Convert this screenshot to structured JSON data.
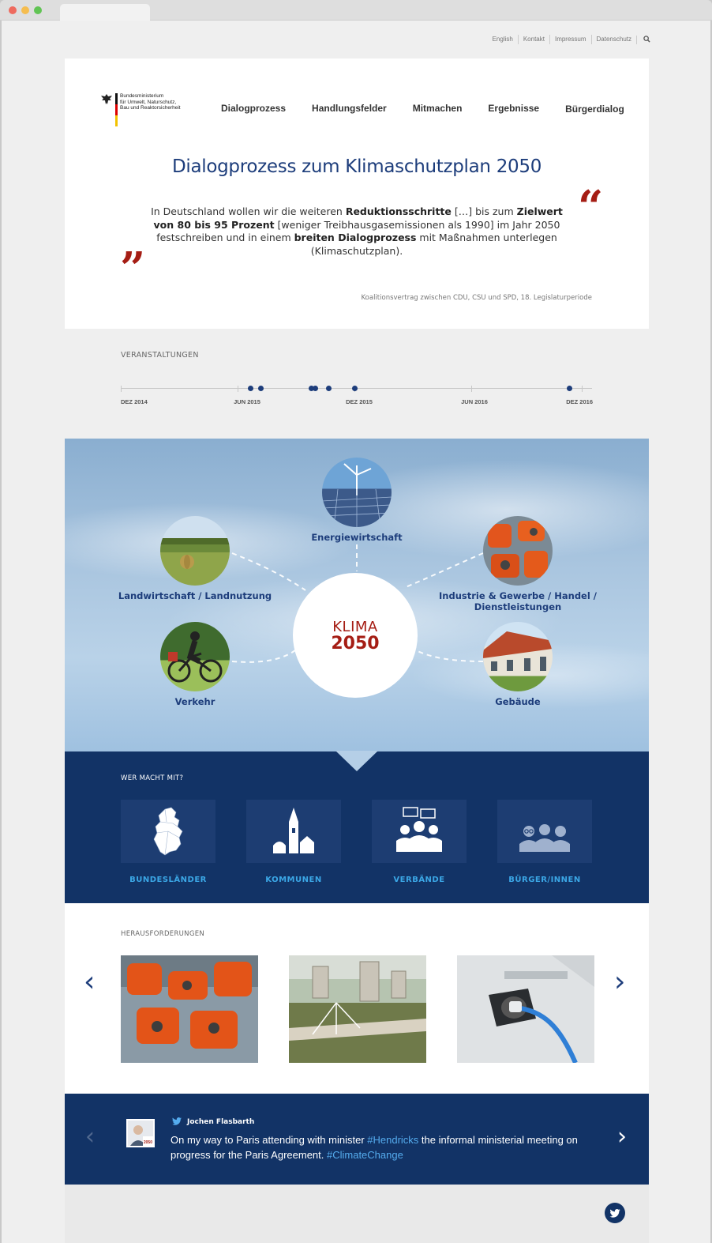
{
  "util_nav": {
    "english": "English",
    "contact": "Kontakt",
    "imprint": "Impressum",
    "privacy": "Datenschutz"
  },
  "logo": {
    "line1": "Bundesministerium",
    "line2": "für Umwelt, Naturschutz,",
    "line3": "Bau und Reaktorsicherheit"
  },
  "nav": [
    "Dialogprozess",
    "Handlungsfelder",
    "Mitmachen",
    "Ergebnisse",
    "Bürgerdialog"
  ],
  "hero": {
    "title": "Dialogprozess zum Klimaschutzplan 2050",
    "quote": {
      "p1": "In Deutschland wollen wir die weiteren ",
      "b1": "Reduktionsschritte",
      "p2": " […] bis zum ",
      "b2": "Zielwert von 80 bis 95 Prozent",
      "p3": " [weniger Treibhausgasemissionen als 1990] im Jahr 2050 festschreiben und in einem ",
      "b3": "breiten Dialogprozess",
      "p4": " mit Maßnahmen unterlegen (Klimaschutzplan)."
    },
    "quote_open": "“",
    "quote_close": "”",
    "source": "Koalitionsvertrag zwischen CDU, CSU und SPD, 18. Legislaturperiode"
  },
  "events": {
    "label": "VERANSTALTUNGEN",
    "ticks": [
      "DEZ 2014",
      "JUN 2015",
      "DEZ 2015",
      "JUN 2016",
      "DEZ 2016"
    ]
  },
  "klima": {
    "center_top": "KLIMA",
    "center_bottom": "2050",
    "topics": {
      "energie": "Energiewirtschaft",
      "land": "Landwirtschaft / Landnutzung",
      "industrie": "Industrie & Gewerbe / Handel / Dienstleistungen",
      "verkehr": "Verkehr",
      "gebaeude": "Gebäude"
    }
  },
  "who": {
    "label": "WER MACHT MIT?",
    "items": [
      "BUNDESLÄNDER",
      "KOMMUNEN",
      "VERBÄNDE",
      "BÜRGER/INNEN"
    ]
  },
  "challenges": {
    "label": "HERAUSFORDERUNGEN",
    "prev": "‹",
    "next": "›"
  },
  "tweet": {
    "user": "Jochen Flasbarth",
    "t1": "On my way to Paris attending with minister ",
    "h1": "#Hendricks",
    "t2": " the informal ministerial meeting on progress for the Paris Agreement. ",
    "h2": "#ClimateChange",
    "avatar_tag": "2050",
    "prev": "‹",
    "next": "›"
  },
  "colors": {
    "navy": "#123366",
    "title_blue": "#1d3d7b",
    "accent_red": "#a51d14",
    "link_blue": "#3ba7e6"
  }
}
